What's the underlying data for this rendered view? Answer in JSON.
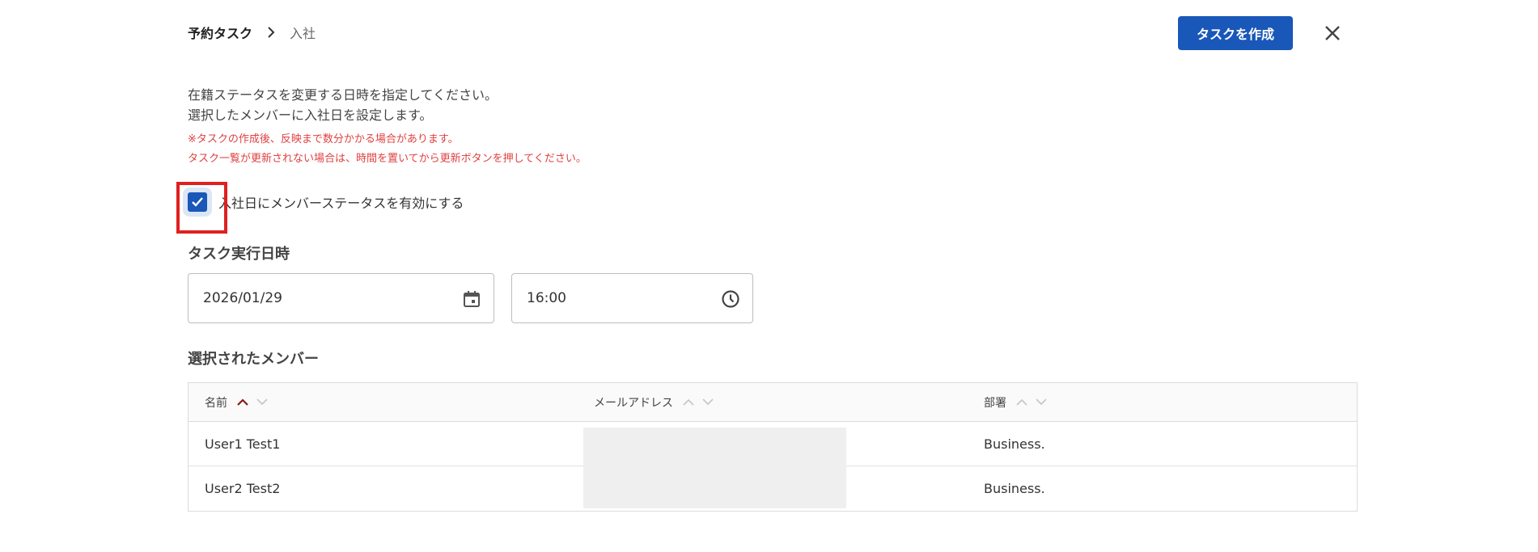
{
  "header": {
    "breadcrumb_root": "予約タスク",
    "breadcrumb_current": "入社",
    "create_button": "タスクを作成",
    "close_icon": "close-icon"
  },
  "description": {
    "line1": "在籍ステータスを変更する日時を指定してください。",
    "line2": "選択したメンバーに入社日を設定します。",
    "note1": "※タスクの作成後、反映まで数分かかる場合があります。",
    "note2": "タスク一覧が更新されない場合は、時間を置いてから更新ボタンを押してください。"
  },
  "checkbox": {
    "label": "入社日にメンバーステータスを有効にする",
    "checked": true
  },
  "schedule": {
    "title": "タスク実行日時",
    "date_value": "2026/01/29",
    "time_value": "16:00",
    "date_icon": "calendar-icon",
    "time_icon": "clock-icon"
  },
  "members": {
    "title": "選択されたメンバー",
    "columns": [
      "名前",
      "メールアドレス",
      "部署"
    ],
    "rows": [
      {
        "name": "User1 Test1",
        "email": "",
        "department": "Business."
      },
      {
        "name": "User2 Test2",
        "email": "",
        "department": "Business."
      }
    ]
  },
  "colors": {
    "primary": "#1957b8",
    "warning_text": "#e04040",
    "highlight": "#e02020",
    "sort_active": "#8b1a1a"
  }
}
